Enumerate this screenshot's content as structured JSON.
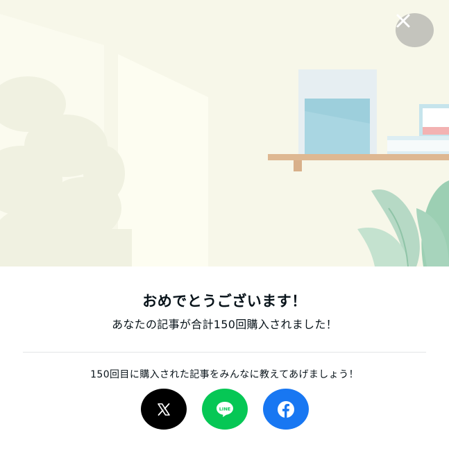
{
  "modal": {
    "title": "おめでとうございます！",
    "message": "あなたの記事が合計150回購入されました！",
    "share_prompt": "150回目に購入された記事をみんなに教えてあげましょう！",
    "line_logo_text": "LINE"
  },
  "icons": {
    "close": "close-icon",
    "x": "x-logo-icon",
    "line": "line-logo-icon",
    "facebook": "facebook-logo-icon"
  },
  "colors": {
    "hero_background": "#f7f7e9",
    "close_button": "#c4c4bd",
    "x": "#000000",
    "line": "#06c755",
    "facebook": "#1877f2",
    "text": "#08131a"
  }
}
